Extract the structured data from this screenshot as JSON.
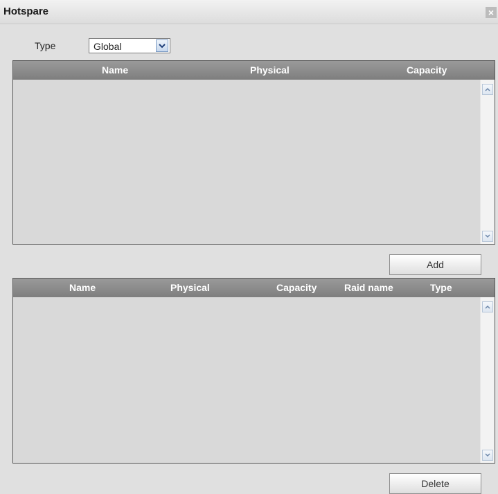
{
  "dialog": {
    "title": "Hotspare",
    "close_label": "×"
  },
  "type_field": {
    "label": "Type",
    "selected": "Global"
  },
  "available_table": {
    "headers": [
      "Name",
      "Physical",
      "Capacity"
    ],
    "rows": []
  },
  "add_button": "Add",
  "hotspare_table": {
    "headers": [
      "Name",
      "Physical",
      "Capacity",
      "Raid name",
      "Type"
    ],
    "rows": []
  },
  "delete_button": "Delete",
  "icons": {
    "close": "close-icon",
    "dropdown": "chevron-down-icon",
    "scroll_up": "scroll-up-icon",
    "scroll_down": "scroll-down-icon"
  }
}
